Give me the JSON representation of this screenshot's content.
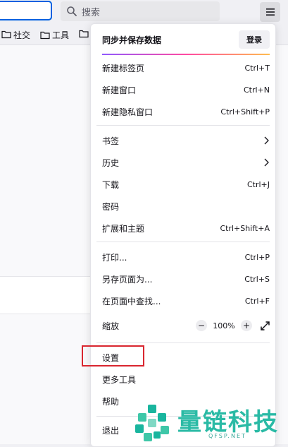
{
  "toolbar": {
    "search_placeholder": "搜索",
    "bookmarks": [
      {
        "label": "社交"
      },
      {
        "label": "工具"
      }
    ]
  },
  "menu": {
    "sync_title": "同步并保存数据",
    "login_label": "登录",
    "group1": [
      {
        "label": "新建标签页",
        "shortcut": "Ctrl+T"
      },
      {
        "label": "新建窗口",
        "shortcut": "Ctrl+N"
      },
      {
        "label": "新建隐私窗口",
        "shortcut": "Ctrl+Shift+P"
      }
    ],
    "group2": [
      {
        "label": "书签",
        "shortcut": ""
      },
      {
        "label": "历史",
        "shortcut": ""
      },
      {
        "label": "下载",
        "shortcut": "Ctrl+J"
      },
      {
        "label": "密码",
        "shortcut": ""
      },
      {
        "label": "扩展和主题",
        "shortcut": "Ctrl+Shift+A"
      }
    ],
    "group3": [
      {
        "label": "打印...",
        "shortcut": "Ctrl+P"
      },
      {
        "label": "另存页面为...",
        "shortcut": "Ctrl+S"
      },
      {
        "label": "在页面中查找...",
        "shortcut": "Ctrl+F"
      }
    ],
    "zoom": {
      "label": "缩放",
      "minus": "−",
      "value": "100%",
      "plus": "+"
    },
    "group4": [
      {
        "label": "设置"
      },
      {
        "label": "更多工具"
      },
      {
        "label": "帮助"
      }
    ],
    "exit_label": "退出"
  },
  "watermark": {
    "text": "量链科技",
    "sub": "QFSP.NET"
  },
  "colors": {
    "accent": "#0061e0",
    "highlight": "#d9262f",
    "watermark": "#19b59e"
  }
}
